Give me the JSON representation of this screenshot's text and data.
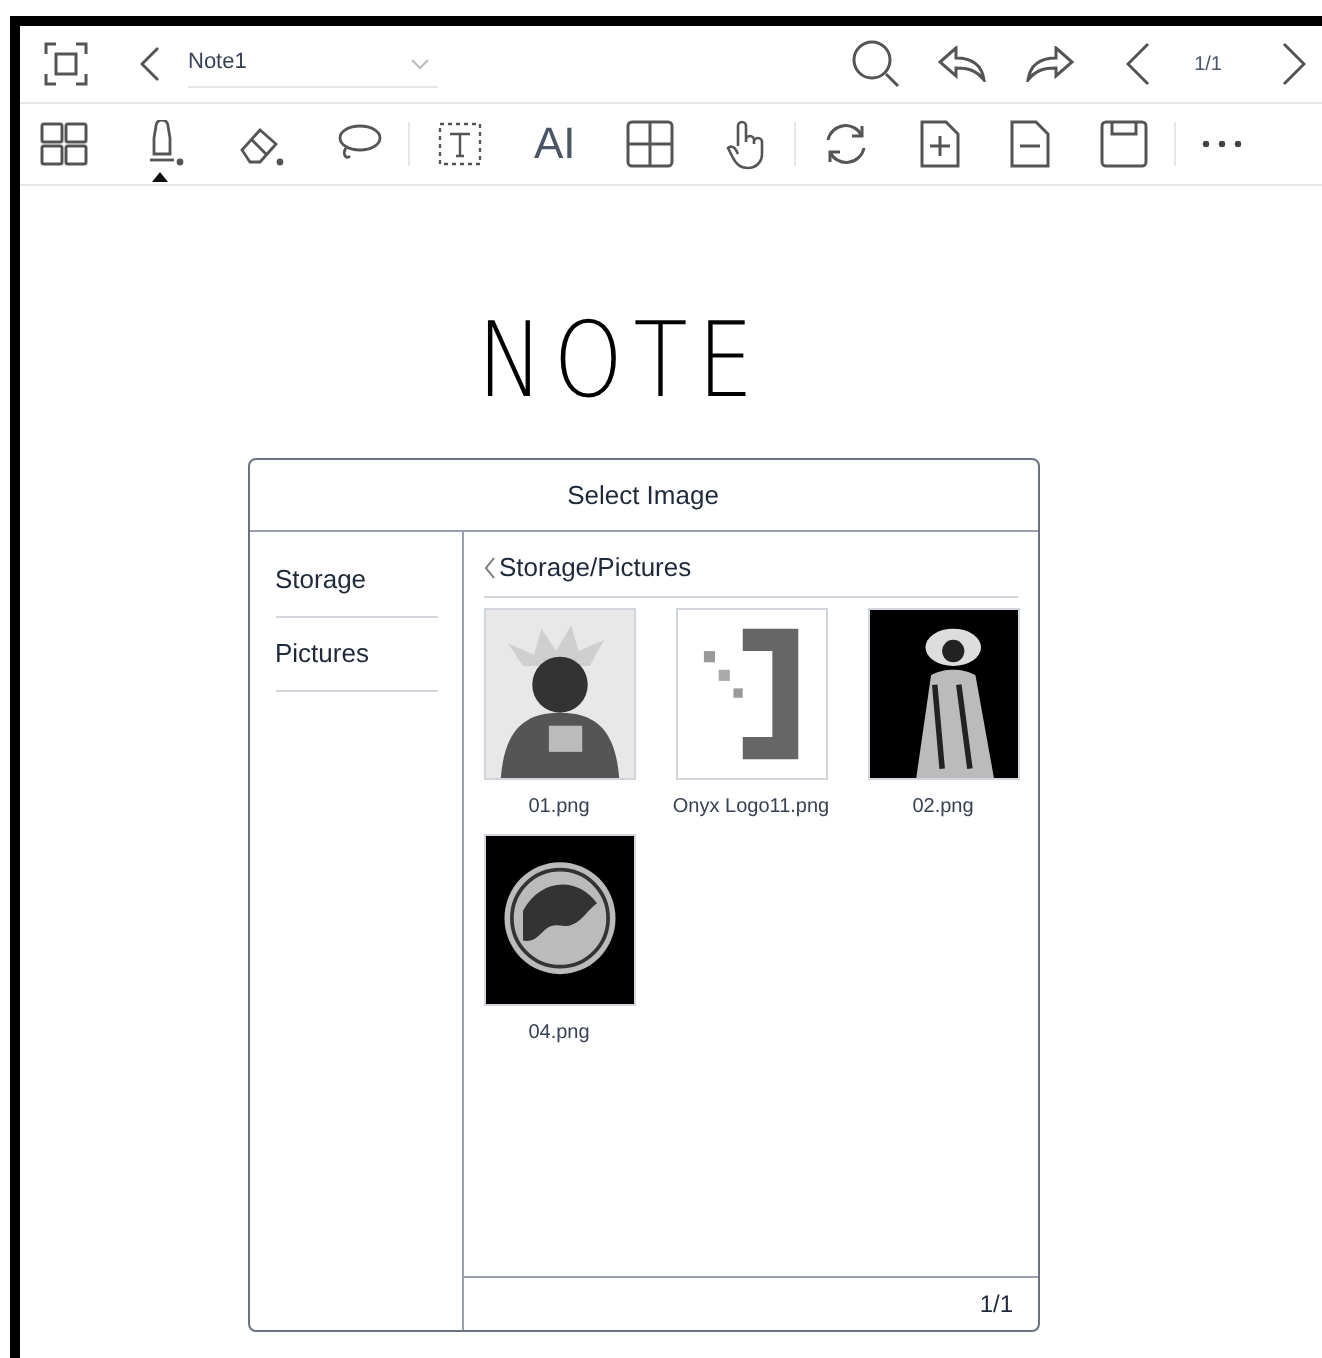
{
  "top_bar": {
    "title": "Note1",
    "page": "1/1"
  },
  "toolbar": {
    "tools": [
      {
        "kind": "pen",
        "selected": true
      },
      {
        "kind": "eraser",
        "selected": false
      },
      {
        "kind": "lasso",
        "selected": false
      }
    ],
    "ai_label": "AI"
  },
  "canvas": {
    "handwriting": "NOTE"
  },
  "dialog": {
    "title": "Select Image",
    "sidebar": [
      "Storage",
      "Pictures"
    ],
    "path": "Storage/Pictures",
    "files": [
      {
        "name": "01.png",
        "kind": "picture"
      },
      {
        "name": "Onyx Logo11.png",
        "kind": "picture"
      },
      {
        "name": "02.png",
        "kind": "picture"
      },
      {
        "name": "04.png",
        "kind": "picture"
      }
    ],
    "page": "1/1"
  }
}
